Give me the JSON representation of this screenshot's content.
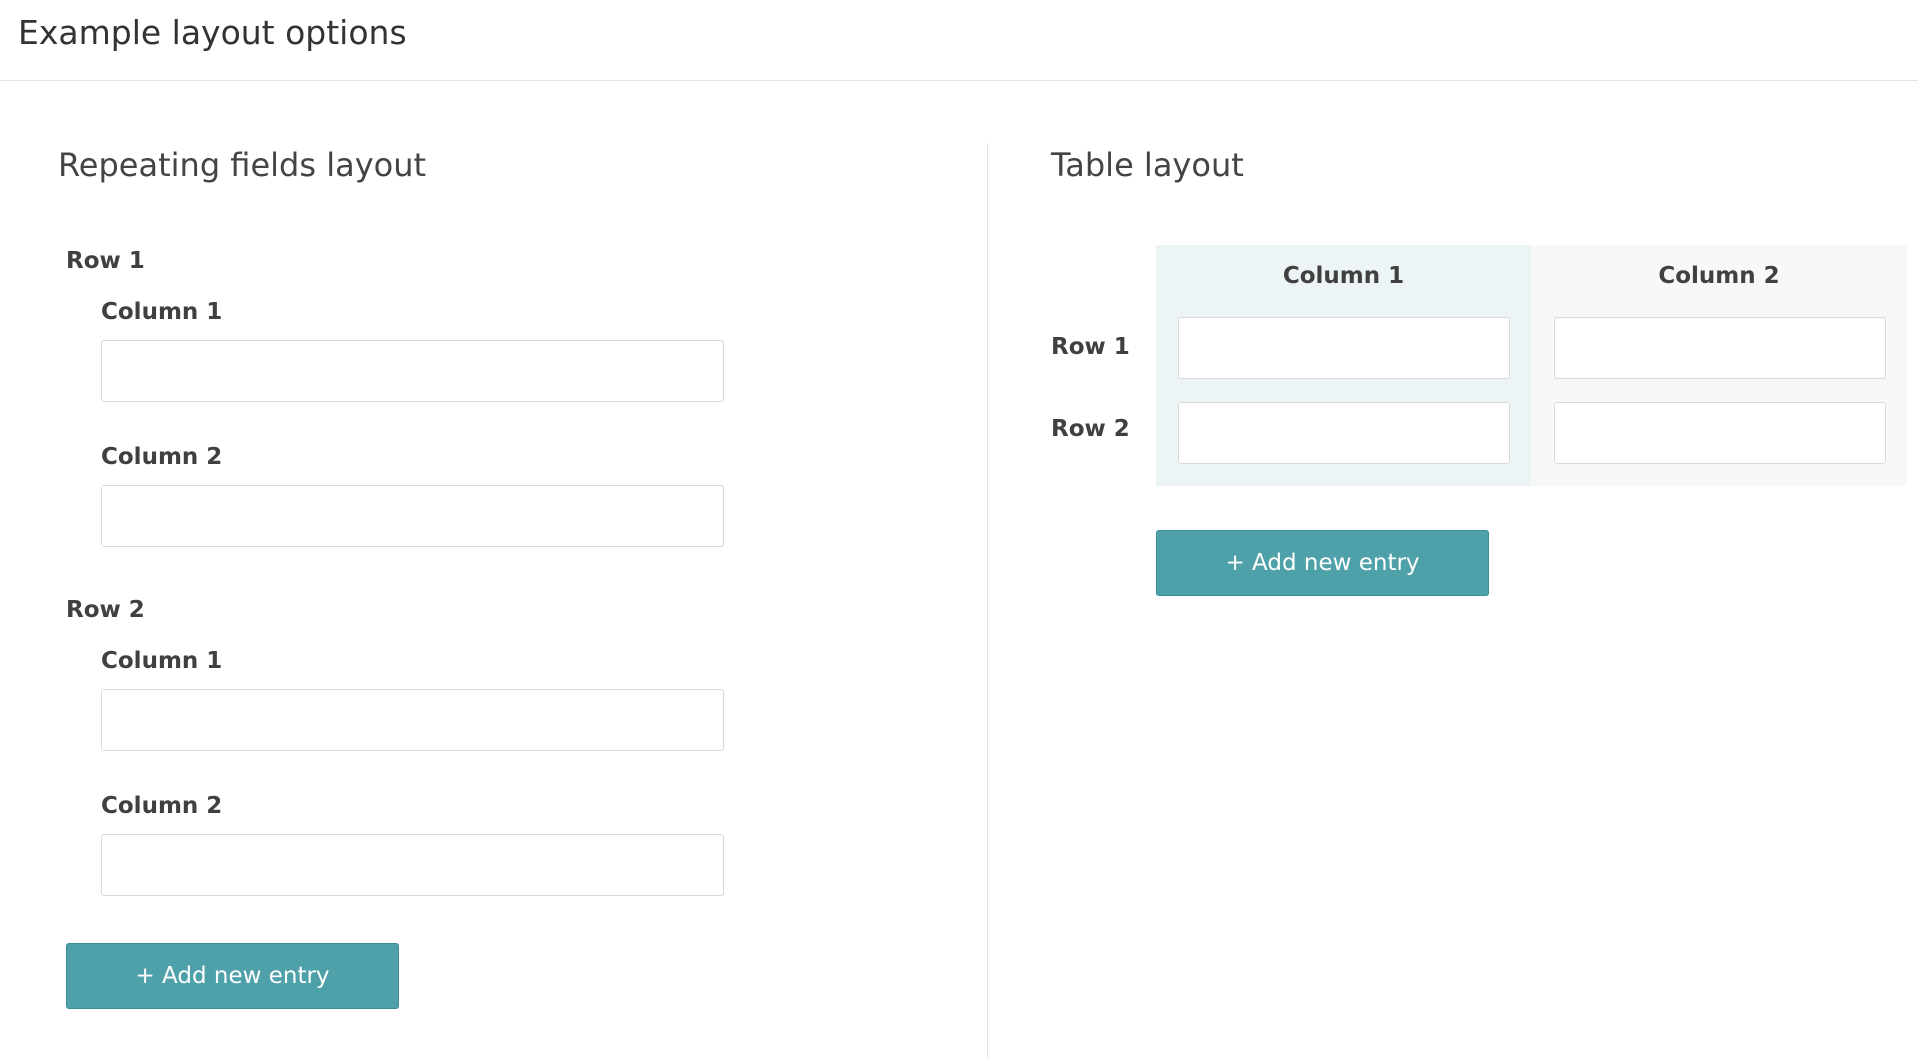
{
  "page": {
    "title": "Example layout options"
  },
  "repeating": {
    "title": "Repeating fields layout",
    "rows": [
      {
        "label": "Row 1",
        "fields": [
          {
            "label": "Column 1",
            "value": "",
            "placeholder": ""
          },
          {
            "label": "Column 2",
            "value": "",
            "placeholder": ""
          }
        ]
      },
      {
        "label": "Row 2",
        "fields": [
          {
            "label": "Column 1",
            "value": "",
            "placeholder": ""
          },
          {
            "label": "Column 2",
            "value": "",
            "placeholder": ""
          }
        ]
      }
    ],
    "add_button_label": "+ Add new entry"
  },
  "table": {
    "title": "Table layout",
    "columns": [
      "Column 1",
      "Column 2"
    ],
    "rows": [
      {
        "label": "Row 1",
        "cells": [
          "",
          ""
        ]
      },
      {
        "label": "Row 2",
        "cells": [
          "",
          ""
        ]
      }
    ],
    "add_button_label": "+ Add new entry"
  },
  "colors": {
    "accent": "#4ea0a9",
    "table_column_1_bg": "#edf4f6",
    "table_column_2_bg": "#f7f9f9",
    "border": "#d9d9d9"
  }
}
